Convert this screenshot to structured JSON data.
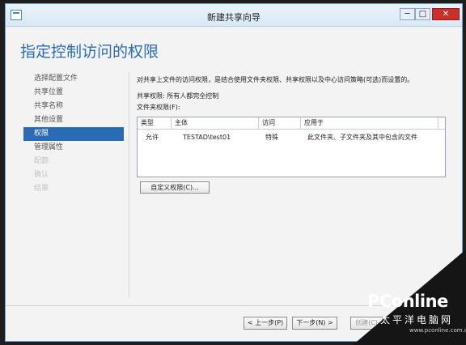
{
  "window": {
    "title": "新建共享向导"
  },
  "title_controls": {
    "minimize": "─",
    "maximize": "□",
    "close": "✕"
  },
  "page_heading": "指定控制访问的权限",
  "nav": {
    "items": [
      {
        "label": "选择配置文件",
        "state": "normal"
      },
      {
        "label": "共享位置",
        "state": "normal"
      },
      {
        "label": "共享名称",
        "state": "normal"
      },
      {
        "label": "其他设置",
        "state": "normal"
      },
      {
        "label": "权限",
        "state": "active"
      },
      {
        "label": "管理属性",
        "state": "normal"
      },
      {
        "label": "配额",
        "state": "disabled"
      },
      {
        "label": "确认",
        "state": "disabled"
      },
      {
        "label": "结果",
        "state": "disabled"
      }
    ]
  },
  "content": {
    "description": "对共享上文件的访问权限，是结合使用文件夹权限、共享权限以及中心访问策略(可选)而设置的。",
    "share_permission": "共享权限: 所有人都完全控制",
    "folder_permission_label": "文件夹权限(F):"
  },
  "table": {
    "columns": [
      "类型",
      "主体",
      "访问",
      "应用于"
    ],
    "rows": [
      [
        "允许",
        "TESTAD\\test01",
        "特殊",
        "此文件夹、子文件夹及其中包含的文件"
      ]
    ]
  },
  "buttons": {
    "custom_permissions": "自定义权限(C)...",
    "previous": "< 上一步(P)",
    "next": "下一步(N) >",
    "create": "创建(C)"
  },
  "watermark": {
    "logo": "PConline",
    "sub": "太平洋电脑网",
    "url": "www.pconline.com.cn"
  },
  "colors": {
    "accent": "#2a6bb5",
    "close_button": "#c9302c"
  }
}
